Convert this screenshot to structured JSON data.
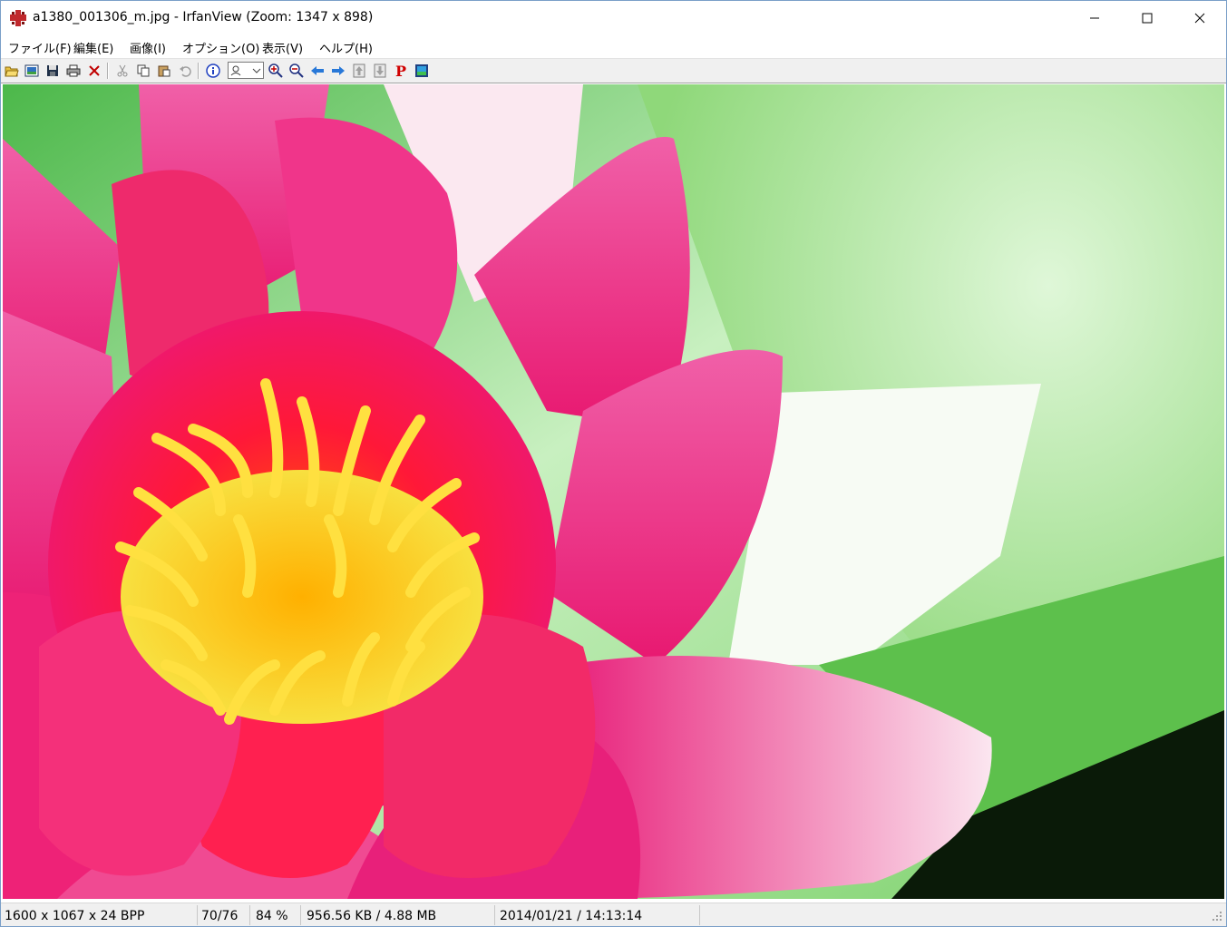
{
  "window": {
    "title": "a1380_001306_m.jpg - IrfanView (Zoom: 1347 x 898)",
    "app_icon": "irfanview-red-cat-icon",
    "controls": [
      "minimize-icon",
      "maximize-icon",
      "close-icon"
    ]
  },
  "menubar": {
    "items": [
      {
        "label": "ファイル(F)"
      },
      {
        "label": "編集(E)"
      },
      {
        "label": "画像(I)"
      },
      {
        "label": "オプション(O)"
      },
      {
        "label": "表示(V)"
      },
      {
        "label": "ヘルプ(H)"
      }
    ]
  },
  "toolbar": {
    "buttons": [
      "open-icon",
      "thumbnails-icon",
      "save-icon",
      "print-icon",
      "delete-icon",
      "cut-icon",
      "copy-icon",
      "paste-icon",
      "undo-icon",
      "info-icon",
      "effects-combo",
      "zoom-in-icon",
      "zoom-out-icon",
      "previous-icon",
      "next-icon",
      "page-up-icon",
      "page-down-icon",
      "paint-icon",
      "slideshow-icon"
    ],
    "paint_letter": "P"
  },
  "image": {
    "subject": "pink-water-lily-photo",
    "colors": {
      "petal": "#e8207a",
      "center": "#ff2040",
      "stamen": "#f8d020",
      "leaf": "#6ccf5a",
      "background": "#b8ecb0"
    }
  },
  "statusbar": {
    "dimensions": "1600 x 1067 x 24 BPP",
    "index": "70/76",
    "zoom": "84 %",
    "filesize": "956.56 KB / 4.88 MB",
    "datetime": "2014/01/21 / 14:13:14"
  }
}
